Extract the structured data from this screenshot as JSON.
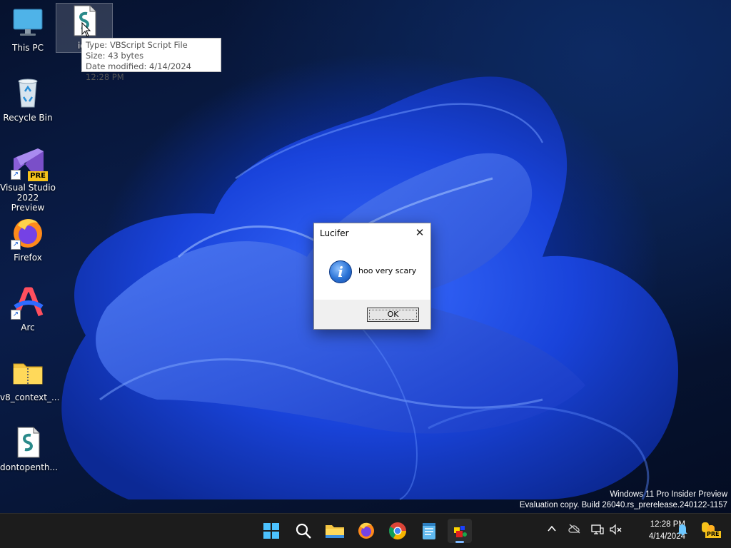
{
  "desktop": {
    "icons": [
      {
        "label": "This PC"
      },
      {
        "label": "idk"
      },
      {
        "label": "Recycle Bin"
      },
      {
        "label": "Visual Studio\n2022 Preview",
        "badge": "PRE"
      },
      {
        "label": "Firefox"
      },
      {
        "label": "Arc"
      },
      {
        "label": "v8_context_..."
      },
      {
        "label": "dontopenth..."
      }
    ]
  },
  "tooltip": {
    "type": "Type: VBScript Script File",
    "size": "Size: 43 bytes",
    "modified": "Date modified: 4/14/2024 12:28 PM"
  },
  "dialog": {
    "title": "Lucifer",
    "close_glyph": "✕",
    "icon": "info-icon",
    "icon_glyph": "i",
    "message": "hoo very scary",
    "ok_label": "OK"
  },
  "watermark": {
    "line1": "Windows 11 Pro Insider Preview",
    "line2": "Evaluation copy. Build 26040.rs_prerelease.240122-1157"
  },
  "taskbar": {
    "apps": [
      "start-icon",
      "search-icon",
      "file-explorer-icon",
      "firefox-icon",
      "chrome-icon",
      "notepad-icon",
      "script-app-icon"
    ],
    "tray_badge": "PRE",
    "clock": {
      "time": "12:28 PM",
      "date": "4/14/2024"
    }
  },
  "colors": {
    "accent": "#7cb7ff",
    "taskbar": "#1c1c1c",
    "wallpaper_blue": "#1a3fd8"
  }
}
